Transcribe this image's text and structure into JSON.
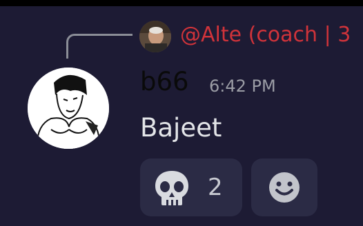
{
  "reply": {
    "author_display": "@Alte (coach | 3",
    "avatar_icon": "elderly-man-avatar"
  },
  "message": {
    "username": "b66",
    "timestamp": "6:42 PM",
    "text": "Bajeet",
    "avatar_icon": "muscular-man-drawing-avatar"
  },
  "reactions": [
    {
      "emoji_icon": "skull-icon",
      "count": "2"
    }
  ],
  "add_reaction_icon": "smiley-face-icon",
  "colors": {
    "background": "#1d1b34",
    "reply_name": "#d0333a",
    "username": "#0a0a0a",
    "timestamp": "#9b9da5",
    "message_text": "#e3e5e8",
    "reaction_bg": "#2b2b45"
  }
}
